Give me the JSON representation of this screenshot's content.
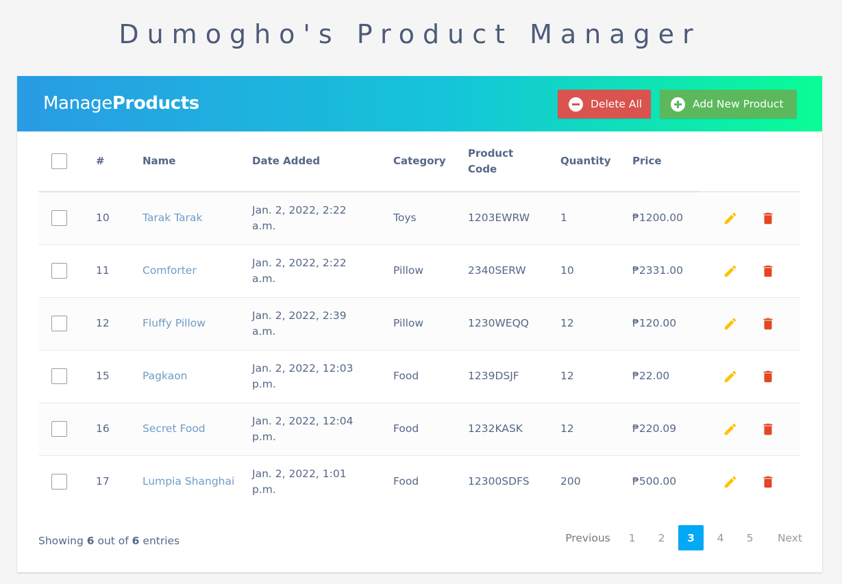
{
  "app_title": "Dumogho's Product Manager",
  "header": {
    "brand_light": "Manage",
    "brand_bold": "Products",
    "delete_all_label": "Delete All",
    "add_new_label": "Add New Product"
  },
  "table": {
    "columns": {
      "number": "#",
      "name": "Name",
      "date_added": "Date Added",
      "category": "Category",
      "product_code_line1": "Product",
      "product_code_line2": "Code",
      "quantity": "Quantity",
      "price": "Price"
    },
    "rows": [
      {
        "id": "10",
        "name": "Tarak Tarak",
        "date": "Jan. 2, 2022, 2:22",
        "time": "a.m.",
        "category": "Toys",
        "code": "1203EWRW",
        "quantity": "1",
        "price": "₱1200.00"
      },
      {
        "id": "11",
        "name": "Comforter",
        "date": "Jan. 2, 2022, 2:22",
        "time": "a.m.",
        "category": "Pillow",
        "code": "2340SERW",
        "quantity": "10",
        "price": "₱2331.00"
      },
      {
        "id": "12",
        "name": "Fluffy Pillow",
        "date": "Jan. 2, 2022, 2:39",
        "time": "a.m.",
        "category": "Pillow",
        "code": "1230WEQQ",
        "quantity": "12",
        "price": "₱120.00"
      },
      {
        "id": "15",
        "name": "Pagkaon",
        "date": "Jan. 2, 2022, 12:03",
        "time": "p.m.",
        "category": "Food",
        "code": "1239DSJF",
        "quantity": "12",
        "price": "₱22.00"
      },
      {
        "id": "16",
        "name": "Secret Food",
        "date": "Jan. 2, 2022, 12:04",
        "time": "p.m.",
        "category": "Food",
        "code": "1232KASK",
        "quantity": "12",
        "price": "₱220.09"
      },
      {
        "id": "17",
        "name": "Lumpia Shanghai",
        "date": "Jan. 2, 2022, 1:01",
        "time": "p.m.",
        "category": "Food",
        "code": "12300SDFS",
        "quantity": "200",
        "price": "₱500.00"
      }
    ]
  },
  "footer": {
    "showing_prefix": "Showing",
    "shown_count": "6",
    "out_of": "out of",
    "total_count": "6",
    "entries_suffix": "entries"
  },
  "pagination": {
    "previous": "Previous",
    "pages": [
      "1",
      "2",
      "3",
      "4",
      "5"
    ],
    "active_page": "3",
    "next": "Next"
  },
  "colors": {
    "header_gradient_start": "#299be4",
    "header_gradient_end": "#09fd96",
    "delete_button": "#d9534f",
    "add_button": "#5cb85c",
    "edit_icon": "#FFC107",
    "delete_icon": "#E34724",
    "active_page": "#03A9F4"
  },
  "icons": {
    "delete_all": "minus-circle-icon",
    "add_new": "plus-circle-icon",
    "row_edit": "pencil-icon",
    "row_delete": "trash-icon"
  }
}
